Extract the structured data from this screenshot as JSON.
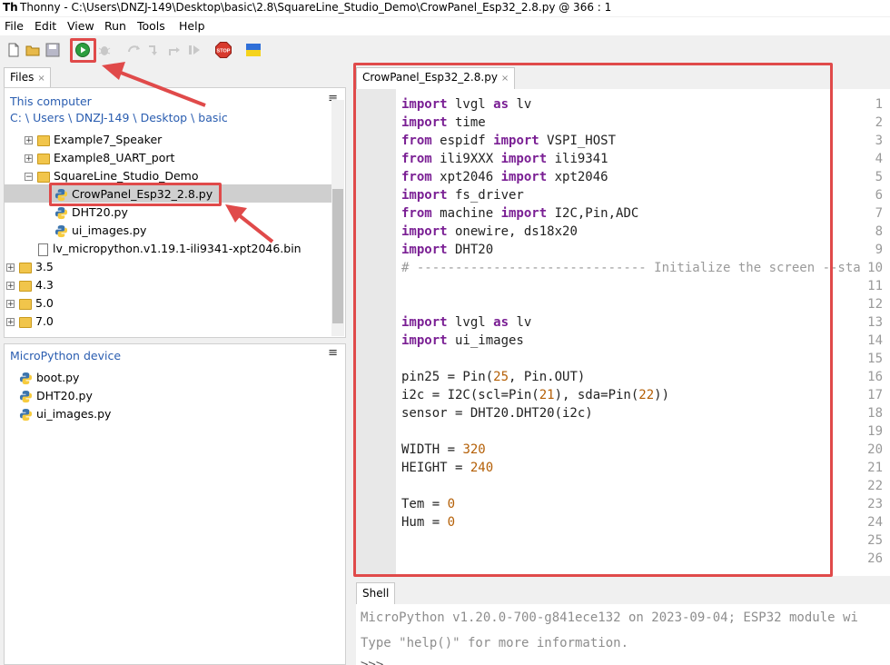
{
  "window": {
    "app_icon_text": "Th",
    "title": "Thonny  -  C:\\Users\\DNZJ-149\\Desktop\\basic\\2.8\\SquareLine_Studio_Demo\\CrowPanel_Esp32_2.8.py  @  366 : 1"
  },
  "menu": [
    "File",
    "Edit",
    "View",
    "Run",
    "Tools",
    "Help"
  ],
  "toolbar": {
    "icons": [
      "new-file-icon",
      "open-file-icon",
      "save-icon",
      "run-icon",
      "debug-icon",
      "step-over-icon",
      "step-into-icon",
      "step-out-icon",
      "resume-icon",
      "stop-icon",
      "ukraine-flag-icon"
    ],
    "stop_label": "STOP"
  },
  "files_tab": {
    "label": "Files",
    "close": "×"
  },
  "files_panel": {
    "header": "This computer",
    "path": "C: \\ Users \\ DNZJ-149 \\ Desktop \\ basic",
    "menu_glyph": "≡",
    "items": [
      {
        "label": "Example7_Speaker",
        "type": "folder",
        "expander": "+"
      },
      {
        "label": "Example8_UART_port",
        "type": "folder",
        "expander": "+"
      },
      {
        "label": "SquareLine_Studio_Demo",
        "type": "folder",
        "expander": "−"
      },
      {
        "label": "CrowPanel_Esp32_2.8.py",
        "type": "python",
        "selected": true
      },
      {
        "label": "DHT20.py",
        "type": "python"
      },
      {
        "label": "ui_images.py",
        "type": "python"
      },
      {
        "label": "lv_micropython.v1.19.1-ili9341-xpt2046.bin",
        "type": "file"
      },
      {
        "label": "3.5",
        "type": "folder",
        "expander": "+"
      },
      {
        "label": "4.3",
        "type": "folder",
        "expander": "+"
      },
      {
        "label": "5.0",
        "type": "folder",
        "expander": "+"
      },
      {
        "label": "7.0",
        "type": "folder",
        "expander": "+"
      }
    ]
  },
  "device_panel": {
    "header": "MicroPython device",
    "menu_glyph": "≡",
    "items": [
      "boot.py",
      "DHT20.py",
      "ui_images.py"
    ]
  },
  "editor": {
    "tab_label": "CrowPanel_Esp32_2.8.py",
    "tab_close": "×",
    "lines": [
      [
        {
          "t": "import",
          "c": "kw"
        },
        {
          "t": " lvgl "
        },
        {
          "t": "as",
          "c": "kw"
        },
        {
          "t": " lv"
        }
      ],
      [
        {
          "t": "import",
          "c": "kw"
        },
        {
          "t": " time"
        }
      ],
      [
        {
          "t": "from",
          "c": "kw"
        },
        {
          "t": " espidf "
        },
        {
          "t": "import",
          "c": "kw"
        },
        {
          "t": " VSPI_HOST"
        }
      ],
      [
        {
          "t": "from",
          "c": "kw"
        },
        {
          "t": " ili9XXX "
        },
        {
          "t": "import",
          "c": "kw"
        },
        {
          "t": " ili9341"
        }
      ],
      [
        {
          "t": "from",
          "c": "kw"
        },
        {
          "t": " xpt2046 "
        },
        {
          "t": "import",
          "c": "kw"
        },
        {
          "t": " xpt2046"
        }
      ],
      [
        {
          "t": "import",
          "c": "kw"
        },
        {
          "t": " fs_driver"
        }
      ],
      [
        {
          "t": "from",
          "c": "kw"
        },
        {
          "t": " machine "
        },
        {
          "t": "import",
          "c": "kw"
        },
        {
          "t": " I2C,Pin,ADC"
        }
      ],
      [
        {
          "t": "import",
          "c": "kw"
        },
        {
          "t": " onewire, ds18x20"
        }
      ],
      [
        {
          "t": "import",
          "c": "kw"
        },
        {
          "t": " DHT20"
        }
      ],
      [
        {
          "t": "# ------------------------------ Initialize the screen --sta",
          "c": "cm"
        }
      ],
      [],
      [],
      [
        {
          "t": "import",
          "c": "kw"
        },
        {
          "t": " lvgl "
        },
        {
          "t": "as",
          "c": "kw"
        },
        {
          "t": " lv"
        }
      ],
      [
        {
          "t": "import",
          "c": "kw"
        },
        {
          "t": " ui_images"
        }
      ],
      [],
      [
        {
          "t": "pin25 = Pin("
        },
        {
          "t": "25",
          "c": "num"
        },
        {
          "t": ", Pin.OUT)"
        }
      ],
      [
        {
          "t": "i2c = I2C(scl=Pin("
        },
        {
          "t": "21",
          "c": "num"
        },
        {
          "t": "), sda=Pin("
        },
        {
          "t": "22",
          "c": "num"
        },
        {
          "t": "))"
        }
      ],
      [
        {
          "t": "sensor = DHT20.DHT20(i2c)"
        }
      ],
      [],
      [
        {
          "t": "WIDTH = "
        },
        {
          "t": "320",
          "c": "num"
        }
      ],
      [
        {
          "t": "HEIGHT = "
        },
        {
          "t": "240",
          "c": "num"
        }
      ],
      [],
      [
        {
          "t": "Tem = "
        },
        {
          "t": "0",
          "c": "num"
        }
      ],
      [
        {
          "t": "Hum = "
        },
        {
          "t": "0",
          "c": "num"
        }
      ],
      [],
      []
    ]
  },
  "shell": {
    "tab_label": "Shell",
    "lines": [
      "MicroPython v1.20.0-700-g841ece132 on 2023-09-04; ESP32 module wi",
      "Type \"help()\" for more information.",
      ">>>"
    ]
  },
  "colors": {
    "annotation": "#e04a4a",
    "keyword": "#7a1f94",
    "number": "#b45f06",
    "comment": "#9a9a9a",
    "folder": "#f1c54b"
  }
}
